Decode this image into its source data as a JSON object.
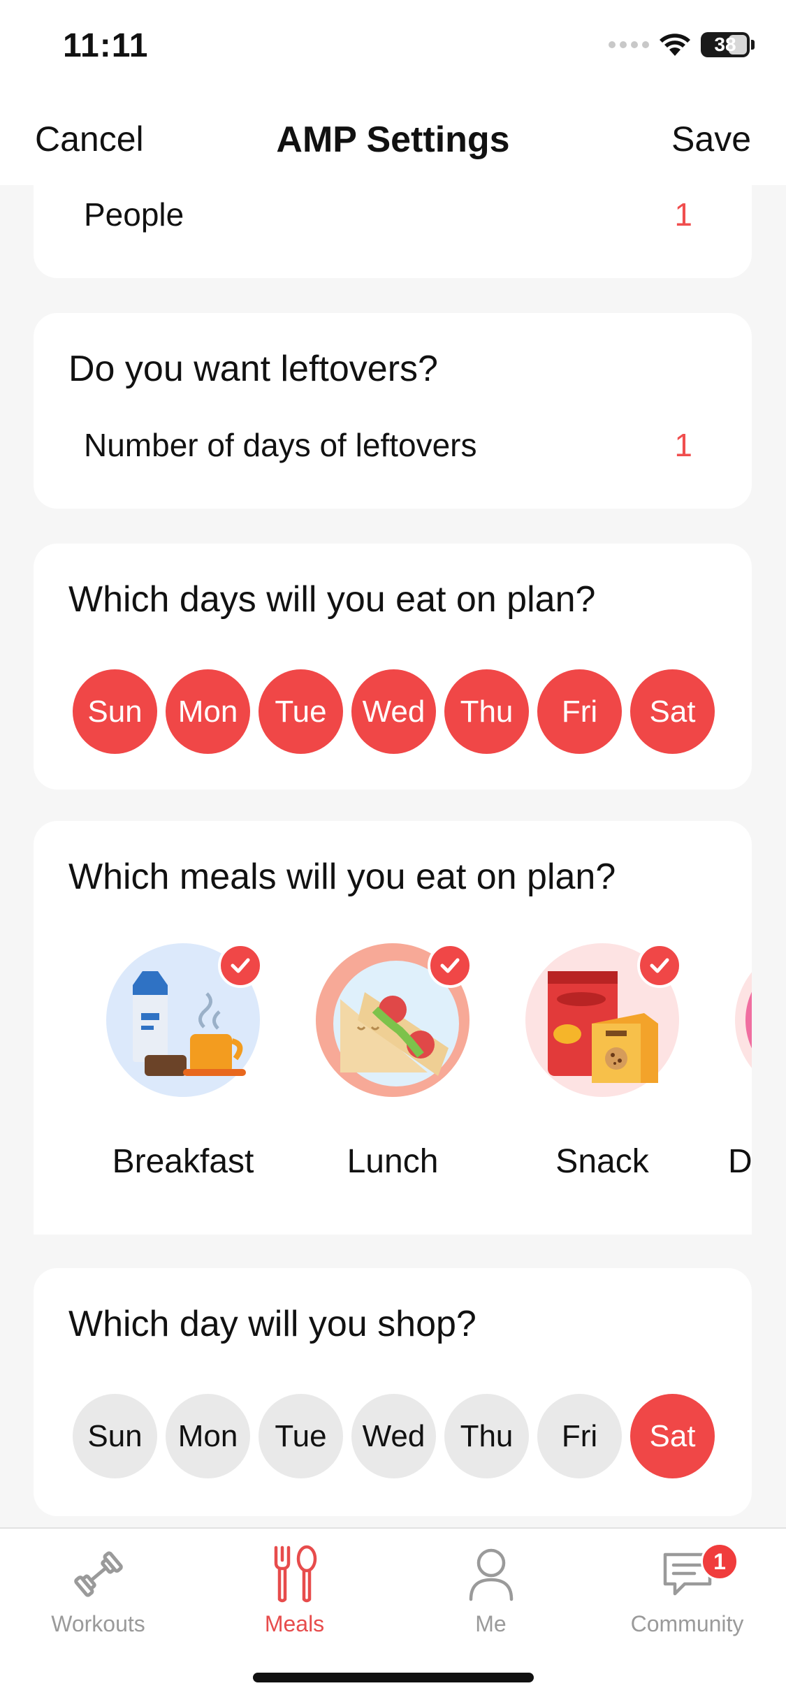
{
  "status": {
    "time": "11:11",
    "battery": "38"
  },
  "nav": {
    "cancel": "Cancel",
    "title": "AMP Settings",
    "save": "Save"
  },
  "people": {
    "label": "People",
    "value": "1"
  },
  "leftovers": {
    "title": "Do you want leftovers?",
    "label": "Number of days of leftovers",
    "value": "1"
  },
  "plan_days": {
    "title": "Which days will you eat on plan?",
    "days": [
      {
        "label": "Sun",
        "selected": true
      },
      {
        "label": "Mon",
        "selected": true
      },
      {
        "label": "Tue",
        "selected": true
      },
      {
        "label": "Wed",
        "selected": true
      },
      {
        "label": "Thu",
        "selected": true
      },
      {
        "label": "Fri",
        "selected": true
      },
      {
        "label": "Sat",
        "selected": true
      }
    ]
  },
  "meals": {
    "title": "Which meals will you eat on plan?",
    "items": [
      {
        "label": "Breakfast",
        "checked": true
      },
      {
        "label": "Lunch",
        "checked": true
      },
      {
        "label": "Snack",
        "checked": true
      },
      {
        "label": "D",
        "checked": false
      }
    ]
  },
  "shop_day": {
    "title": "Which day will you shop?",
    "days": [
      {
        "label": "Sun",
        "selected": false
      },
      {
        "label": "Mon",
        "selected": false
      },
      {
        "label": "Tue",
        "selected": false
      },
      {
        "label": "Wed",
        "selected": false
      },
      {
        "label": "Thu",
        "selected": false
      },
      {
        "label": "Fri",
        "selected": false
      },
      {
        "label": "Sat",
        "selected": true
      }
    ]
  },
  "tabs": [
    {
      "label": "Workouts",
      "icon": "dumbbell-icon",
      "active": false
    },
    {
      "label": "Meals",
      "icon": "fork-spoon-icon",
      "active": true
    },
    {
      "label": "Me",
      "icon": "person-icon",
      "active": false
    },
    {
      "label": "Community",
      "icon": "chat-icon",
      "active": false,
      "badge": "1"
    }
  ],
  "colors": {
    "accent": "#f04747",
    "inactive_pill": "#e9e9e9",
    "background": "#f6f6f6"
  }
}
